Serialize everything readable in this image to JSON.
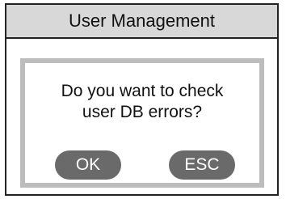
{
  "window": {
    "title": "User Management"
  },
  "dialog": {
    "message_line1": "Do you want to check",
    "message_line2": "user DB errors?",
    "ok_label": "OK",
    "esc_label": "ESC"
  },
  "colors": {
    "titlebar_bg": "#d8d8d8",
    "dialog_border": "#bdbdbd",
    "button_bg": "#6a6a6a",
    "button_text": "#ffffff"
  }
}
